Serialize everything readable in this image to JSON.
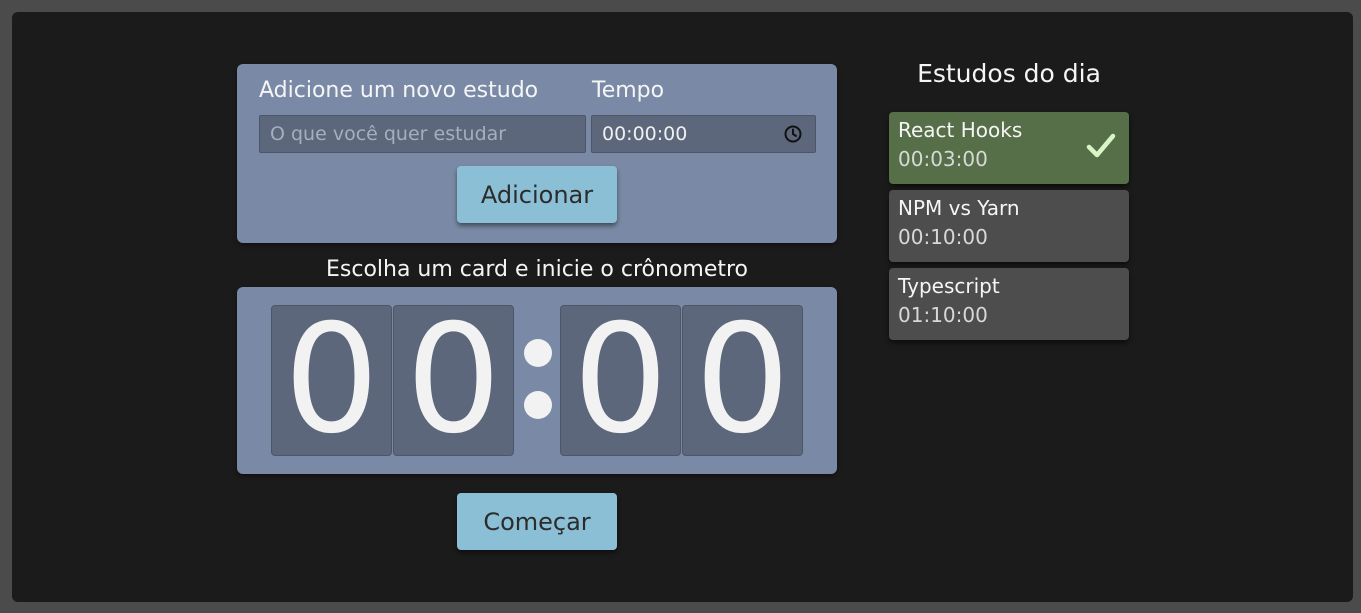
{
  "form": {
    "study_label": "Adicione um novo estudo",
    "study_placeholder": "O que você quer estudar",
    "time_label": "Tempo",
    "time_value": "00:00:00",
    "add_button": "Adicionar"
  },
  "timer": {
    "instruction": "Escolha um card e inicie o crônometro",
    "digits": [
      "0",
      "0",
      "0",
      "0"
    ],
    "start_button": "Começar"
  },
  "sidebar": {
    "title": "Estudos do dia",
    "items": [
      {
        "name": "React Hooks",
        "time": "00:03:00",
        "completed": true
      },
      {
        "name": "NPM vs Yarn",
        "time": "00:10:00",
        "completed": false
      },
      {
        "name": "Typescript",
        "time": "01:10:00",
        "completed": false
      }
    ]
  },
  "colors": {
    "card": "#7a8aa6",
    "button": "#8bbfd6",
    "completed": "#566f48",
    "check": "#d9f5c8"
  },
  "icons": {
    "time_field": "clock-icon",
    "completed": "check-icon"
  }
}
